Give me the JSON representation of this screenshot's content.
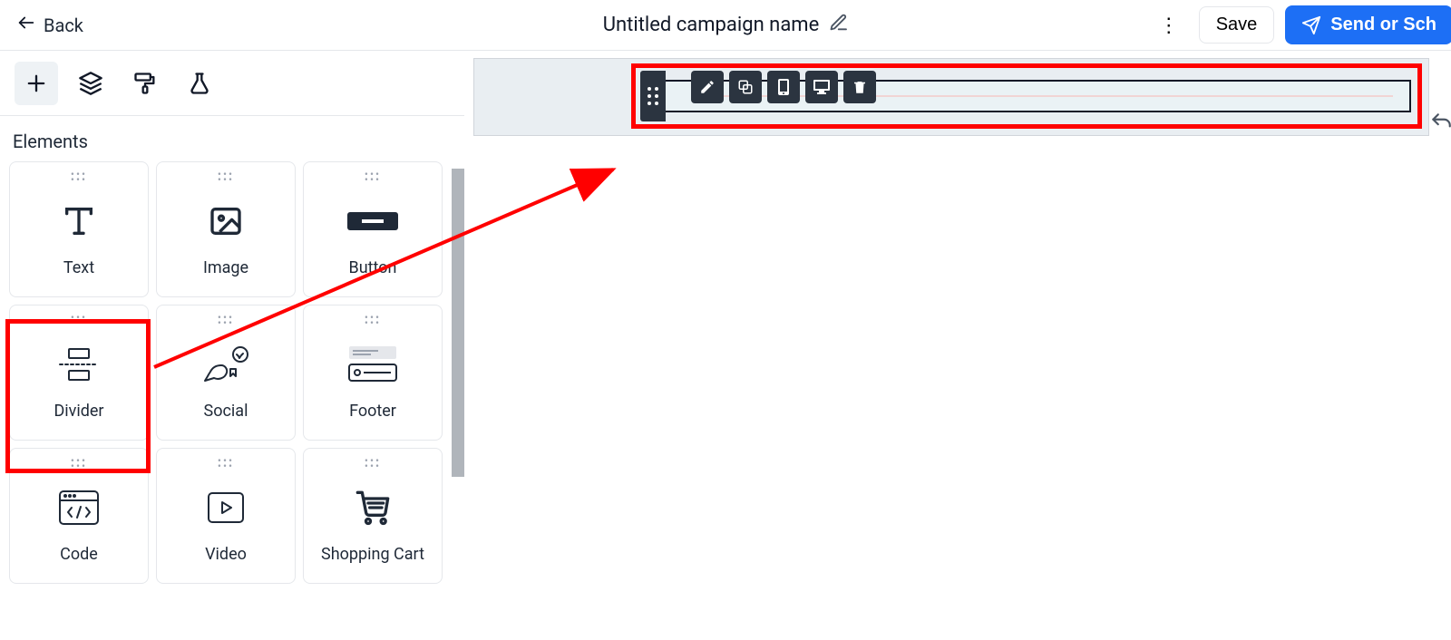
{
  "topbar": {
    "back_label": "Back",
    "title": "Untitled campaign name",
    "more_label": "⋮",
    "save_label": "Save",
    "send_label": "Send or Sch"
  },
  "tooltabs": {
    "add": "add-icon",
    "layers": "layers-icon",
    "brush": "paint-roller-icon",
    "flask": "flask-icon"
  },
  "panel": {
    "title": "Elements",
    "items": [
      {
        "label": "Text",
        "icon": "text-icon"
      },
      {
        "label": "Image",
        "icon": "image-icon"
      },
      {
        "label": "Button",
        "icon": "button-icon"
      },
      {
        "label": "Divider",
        "icon": "divider-icon"
      },
      {
        "label": "Social",
        "icon": "social-icon"
      },
      {
        "label": "Footer",
        "icon": "footer-icon"
      },
      {
        "label": "Code",
        "icon": "code-icon"
      },
      {
        "label": "Video",
        "icon": "video-icon"
      },
      {
        "label": "Shopping Cart",
        "icon": "cart-icon"
      }
    ]
  },
  "block_toolbar": {
    "edit": "edit-icon",
    "duplicate": "duplicate-icon",
    "mobile": "mobile-icon",
    "desktop": "desktop-icon",
    "delete": "delete-icon"
  },
  "colors": {
    "brand": "#1d6ff5",
    "annotation": "#ff0000",
    "toolbar_bg": "#2b3440"
  }
}
